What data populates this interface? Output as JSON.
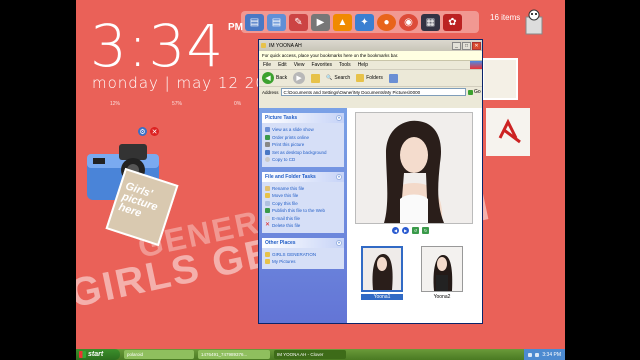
{
  "clock": {
    "time": "3:34",
    "ampm": "PM",
    "date": "monday | may 12 201",
    "stats": [
      "12%",
      "57%",
      "0%"
    ]
  },
  "background_text": [
    "GIRLS GENERATION",
    "GENERATION",
    "GIRLS GENERATION"
  ],
  "desktop": {
    "items_count": "16 items"
  },
  "dock": {
    "icons": [
      "folder-icon",
      "folder-icon",
      "pen-tools-icon",
      "media-player-icon",
      "vlc-icon",
      "paint-icon",
      "firefox-icon",
      "chrome-icon",
      "explorer-icon",
      "gadget-icon"
    ]
  },
  "camera_gadget": {
    "photo_text": "Girls' picture here"
  },
  "window": {
    "title": "IM YOONA AH",
    "infobar": "For quick access, place your bookmarks here on the bookmarks bar.",
    "menu": [
      "File",
      "Edit",
      "View",
      "Favorites",
      "Tools",
      "Help"
    ],
    "toolbar": {
      "back": "Back",
      "search": "Search",
      "folders": "Folders"
    },
    "address": {
      "label": "Address",
      "value": "C:\\Documents and Settings\\Owner\\My Documents\\My Pictures\\0000",
      "go": "Go"
    },
    "picture_tasks": {
      "title": "Picture Tasks",
      "items": [
        "View as a slide show",
        "Order prints online",
        "Print this picture",
        "Set as desktop background",
        "Copy to CD"
      ]
    },
    "file_folder_tasks": {
      "title": "File and Folder Tasks",
      "items": [
        "Rename this file",
        "Move this file",
        "Copy this file",
        "Publish this file to the Web",
        "E-mail this file",
        "Delete this file"
      ]
    },
    "other_places": {
      "title": "Other Places",
      "items": [
        "GIRLS GENERATION",
        "My Pictures"
      ]
    },
    "thumbnails": [
      {
        "name": "Yoona1",
        "selected": true
      },
      {
        "name": "Yoona2",
        "selected": false
      }
    ]
  },
  "taskbar": {
    "start": "start",
    "tasks": [
      "polaroid",
      "1476491_747989376...",
      "IM YOONA AH - Clover"
    ],
    "time": "3:34 PM"
  },
  "colors": {
    "desktop": "#ea6158",
    "taskbar": "#5a8a2c",
    "selection": "#316ac5"
  }
}
